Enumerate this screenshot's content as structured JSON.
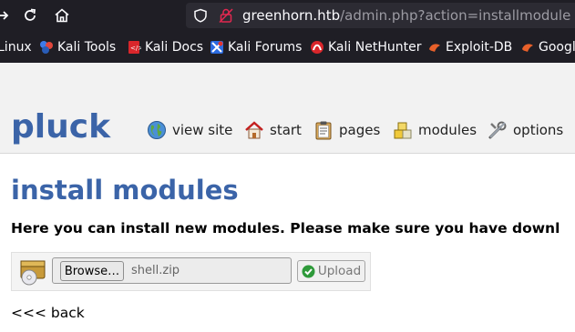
{
  "browser": {
    "url_host": "greenhorn.htb",
    "url_path": "/admin.php?action=installmodule",
    "bookmarks": [
      {
        "label": "Linux",
        "icon": "none"
      },
      {
        "label": "Kali Tools",
        "icon": "kali-tools-icon"
      },
      {
        "label": "Kali Docs",
        "icon": "kali-docs-icon"
      },
      {
        "label": "Kali Forums",
        "icon": "kali-forums-icon"
      },
      {
        "label": "Kali NetHunter",
        "icon": "kali-nethunter-icon"
      },
      {
        "label": "Exploit-DB",
        "icon": "exploit-db-icon"
      },
      {
        "label": "Google",
        "icon": "google-hacking-db-icon"
      }
    ]
  },
  "site": {
    "logo": "pluck",
    "menu": [
      {
        "label": "view site",
        "icon": "globe-icon"
      },
      {
        "label": "start",
        "icon": "house-icon"
      },
      {
        "label": "pages",
        "icon": "clipboard-icon"
      },
      {
        "label": "modules",
        "icon": "modules-blocks-icon"
      },
      {
        "label": "options",
        "icon": "tools-icon"
      }
    ]
  },
  "main": {
    "title": "install modules",
    "intro": "Here you can install new modules. Please make sure you have downl",
    "browse_label": "Browse…",
    "file_name": "shell.zip",
    "upload_label": "Upload",
    "back_label": "<<< back"
  },
  "colors": {
    "brand_blue": "#3b64a8",
    "chrome_dark": "#1f1e25"
  }
}
